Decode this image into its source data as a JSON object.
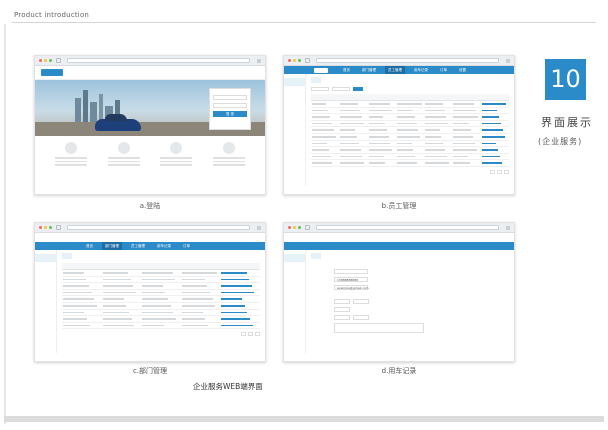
{
  "header": {
    "title": "Product introduction"
  },
  "side": {
    "number": "10",
    "title": "界面展示",
    "subtitle": "(企业服务)"
  },
  "shots": {
    "login": {
      "caption": "a.登陆",
      "login_button": "登 录",
      "features": [
        "",
        "",
        "",
        ""
      ]
    },
    "employees": {
      "caption": "b.员工管理",
      "nav": [
        "首页",
        "部门管理",
        "员工管理",
        "用车记录",
        "订单",
        "设置"
      ],
      "active_nav_index": 2,
      "table_rows": 10
    },
    "departments": {
      "caption": "c.部门管理",
      "nav": [
        "首页",
        "部门管理",
        "员工管理",
        "用车记录",
        "订单"
      ],
      "active_nav_index": 1,
      "table_rows": 9
    },
    "records": {
      "caption": "d.用车记录",
      "phone": "13888888888",
      "email": "example@gmail.com"
    }
  },
  "bottom_caption": "企业服务WEB端界面",
  "colors": {
    "accent": "#2b8bc9"
  }
}
